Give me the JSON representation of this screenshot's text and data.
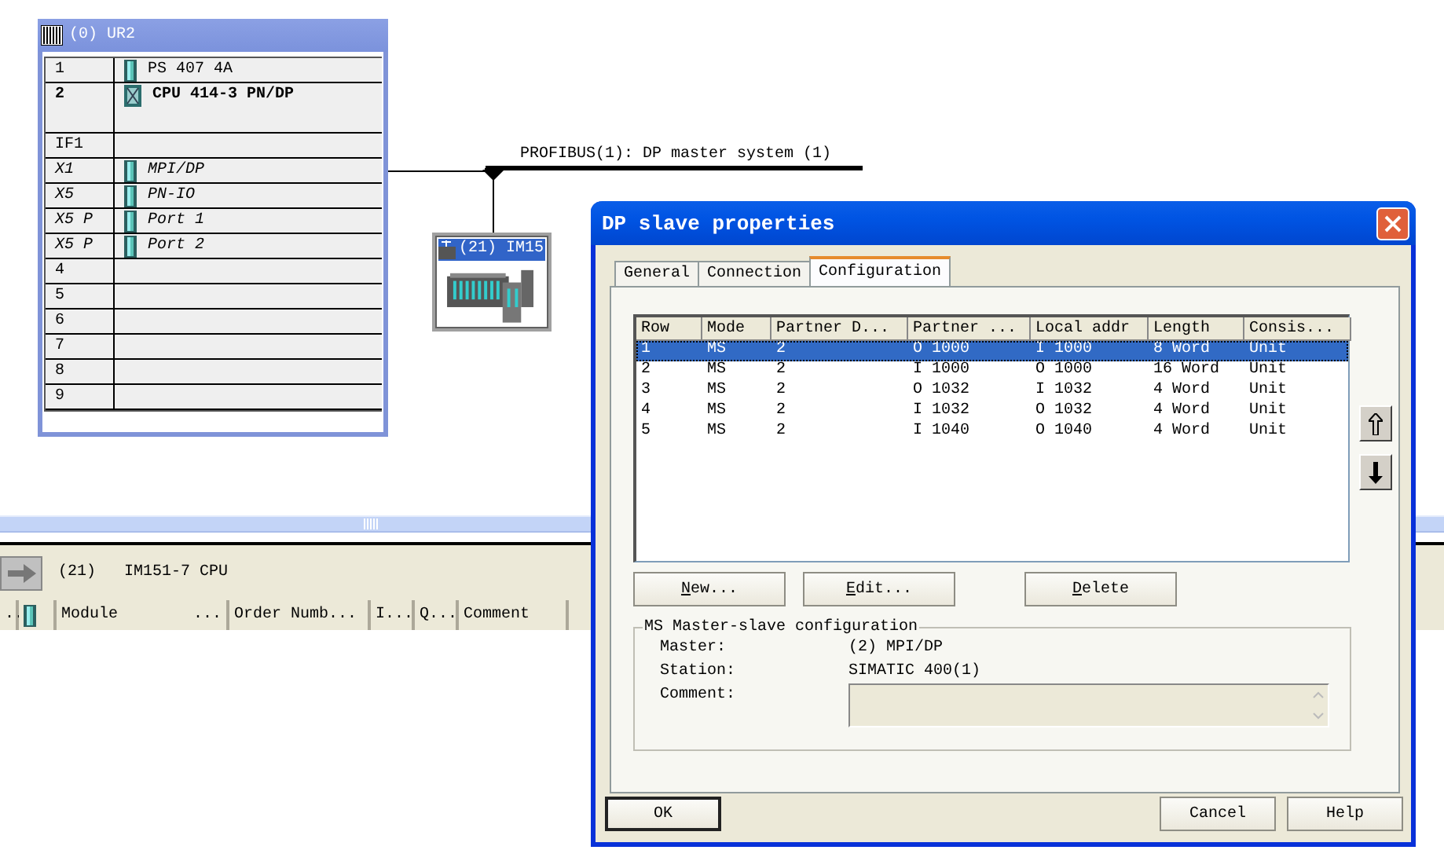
{
  "rack": {
    "title": "(0) UR2",
    "slots": [
      {
        "slot": "1",
        "module": "PS 407 4A",
        "kind": "module"
      },
      {
        "slot": "2",
        "module": "CPU 414-3 PN/DP",
        "kind": "cpu"
      },
      {
        "slot": "IF1",
        "kind": "empty"
      },
      {
        "slot": "X1",
        "module": "MPI/DP",
        "kind": "interface"
      },
      {
        "slot": "X5",
        "module": "PN-IO",
        "kind": "interface"
      },
      {
        "slot": "X5 P",
        "module": "Port 1",
        "kind": "interface"
      },
      {
        "slot": "X5 P",
        "module": "Port 2",
        "kind": "interface"
      },
      {
        "slot": "4",
        "kind": "empty"
      },
      {
        "slot": "5",
        "kind": "empty"
      },
      {
        "slot": "6",
        "kind": "empty"
      },
      {
        "slot": "7",
        "kind": "empty"
      },
      {
        "slot": "8",
        "kind": "empty"
      },
      {
        "slot": "9",
        "kind": "empty"
      }
    ]
  },
  "bus": {
    "label": "PROFIBUS(1): DP master system (1)"
  },
  "slave": {
    "title": "(21) IM15"
  },
  "detail": {
    "number": "(21)",
    "name": "IM151-7 CPU",
    "columns": [
      {
        "label": "..",
        "kind": "text"
      },
      {
        "kind": "icon"
      },
      {
        "label": "Module",
        "suffix": "...",
        "kind": "text"
      },
      {
        "label": "Order Numb...",
        "kind": "text"
      },
      {
        "label": "I...",
        "kind": "text"
      },
      {
        "label": "Q...",
        "kind": "text"
      },
      {
        "label": "Comment",
        "kind": "text"
      }
    ]
  },
  "dialog": {
    "title": "DP slave properties",
    "tabs": [
      {
        "label": "General",
        "selected": false
      },
      {
        "label": "Connection",
        "selected": false
      },
      {
        "label": "Configuration",
        "selected": true
      }
    ],
    "columns": [
      "Row",
      "Mode",
      "Partner D...",
      "Partner ...",
      "Local addr",
      "Length",
      "Consis..."
    ],
    "rows": [
      {
        "cells": [
          "1",
          "MS",
          "2",
          "O 1000",
          "I 1000",
          "8 Word",
          "Unit"
        ],
        "selected": true
      },
      {
        "cells": [
          "2",
          "MS",
          "2",
          "I 1000",
          "O 1000",
          "16 Word",
          "Unit"
        ],
        "selected": false
      },
      {
        "cells": [
          "3",
          "MS",
          "2",
          "O 1032",
          "I 1032",
          "4 Word",
          "Unit"
        ],
        "selected": false
      },
      {
        "cells": [
          "4",
          "MS",
          "2",
          "I 1032",
          "O 1032",
          "4 Word",
          "Unit"
        ],
        "selected": false
      },
      {
        "cells": [
          "5",
          "MS",
          "2",
          "I 1040",
          "O 1040",
          "4 Word",
          "Unit"
        ],
        "selected": false
      }
    ],
    "actions": [
      {
        "label": "New...",
        "underline_first": true
      },
      {
        "label": "Edit...",
        "underline_first": true
      },
      {
        "label": "Delete",
        "underline_first": true
      }
    ],
    "group": {
      "title": "MS Master-slave configuration",
      "fields": [
        {
          "label": "Master:",
          "value": "(2) MPI/DP",
          "kind": "text"
        },
        {
          "label": "Station:",
          "value": "SIMATIC 400(1)",
          "kind": "text"
        },
        {
          "label": "Comment:",
          "kind": "textarea",
          "disabled": true
        }
      ]
    },
    "footer": [
      {
        "label": "OK",
        "default": true
      },
      {
        "label": "Cancel",
        "default": false
      },
      {
        "label": "Help",
        "default": false
      }
    ]
  }
}
